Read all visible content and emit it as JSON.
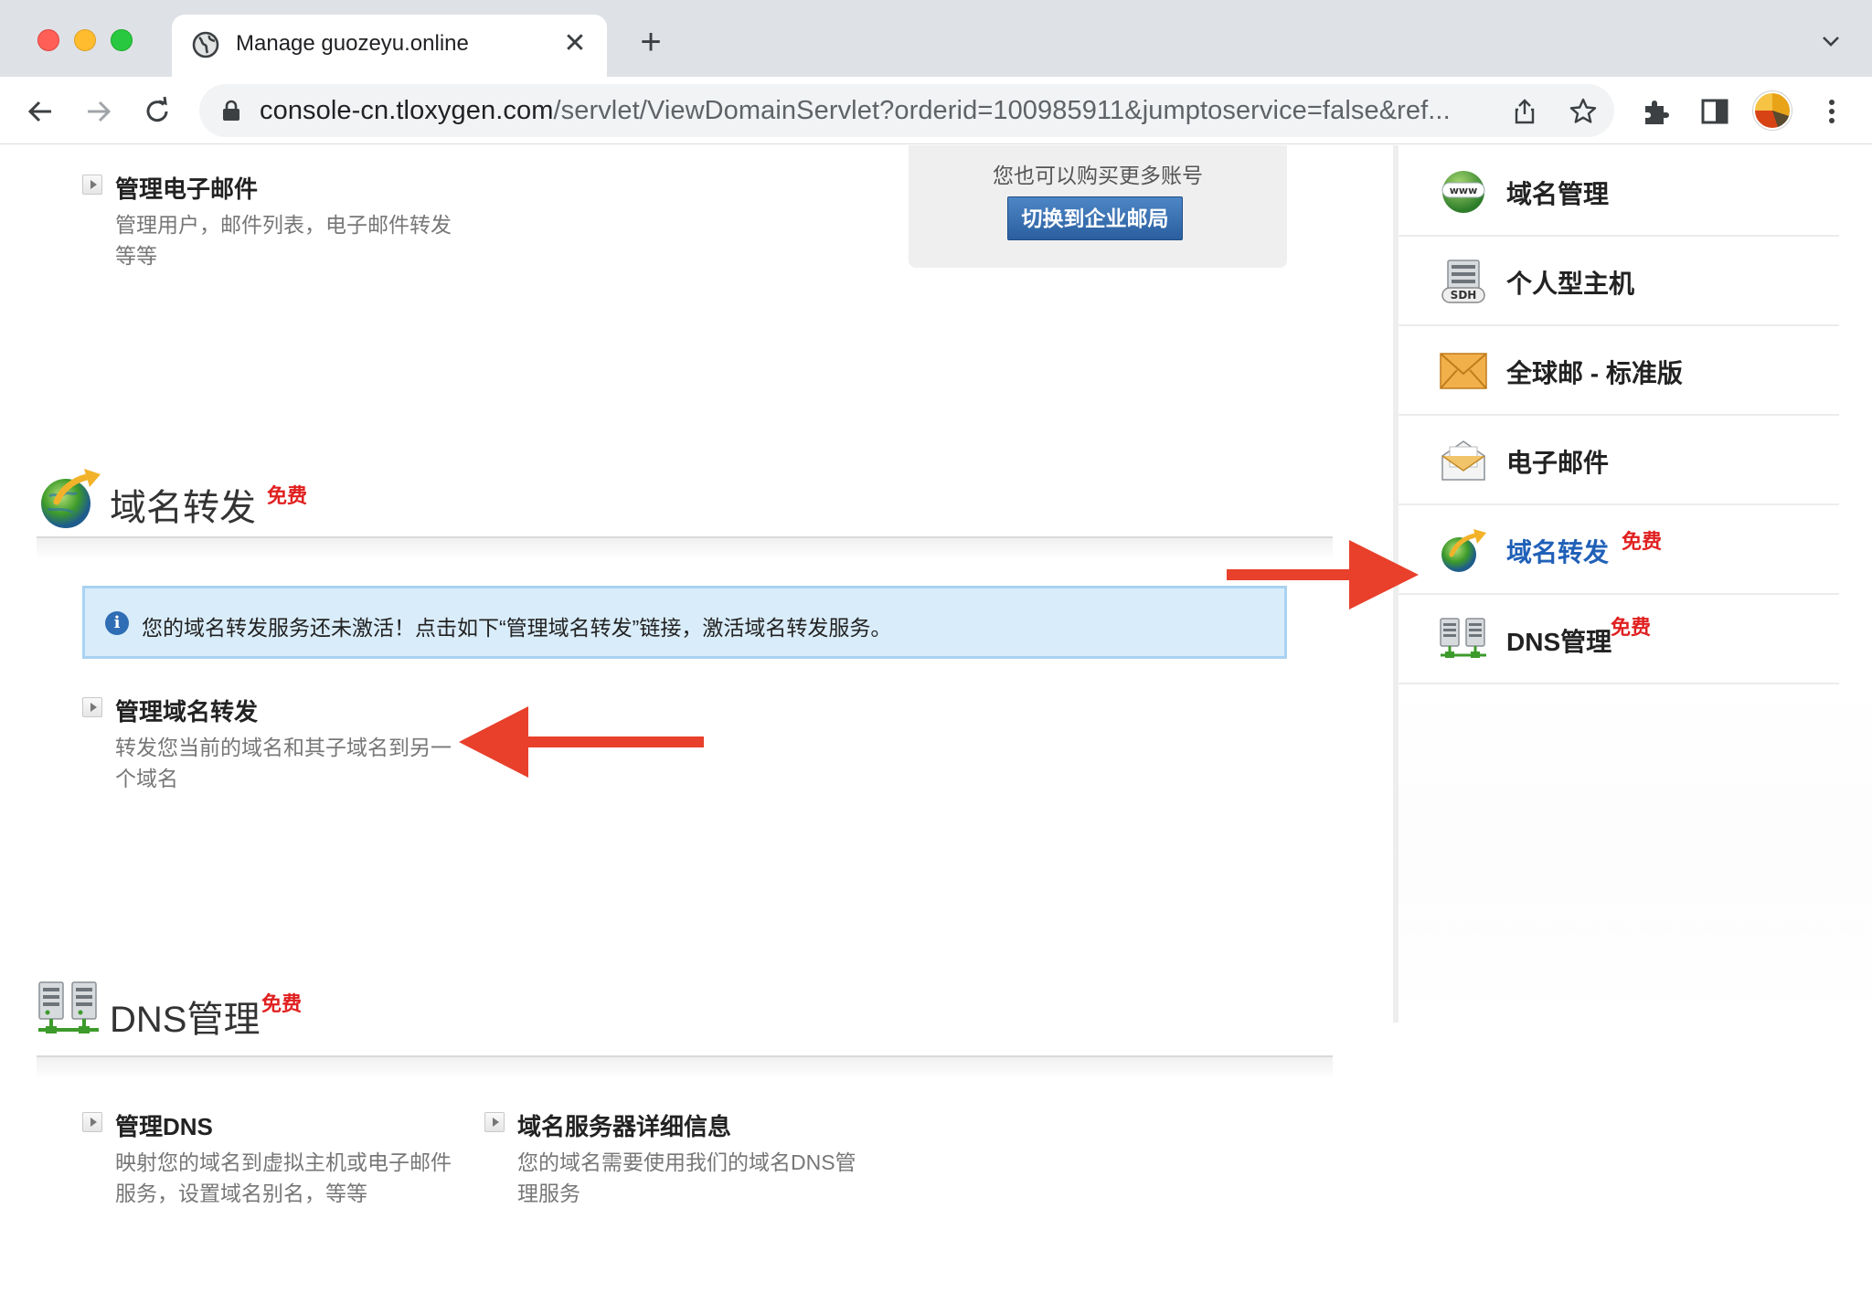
{
  "browser": {
    "tab_title": "Manage guozeyu.online",
    "url_host": "console-cn.tloxygen.com",
    "url_rest": "/servlet/ViewDomainServlet?orderid=100985911&jumptoservice=false&ref..."
  },
  "email_section": {
    "title": "管理电子邮件",
    "desc": "管理用户，邮件列表，电子邮件转发等等",
    "buy_more_text": "您也可以购买更多账号",
    "switch_button": "切换到企业邮局"
  },
  "forwarding_section": {
    "heading": "域名转发",
    "free_badge": "免费",
    "notice": "您的域名转发服务还未激活！点击如下“管理域名转发”链接，激活域名转发服务。",
    "manage_title": "管理域名转发",
    "manage_desc": "转发您当前的域名和其子域名到另一个域名"
  },
  "dns_section": {
    "heading": "DNS管理",
    "free_badge": "免费",
    "items": [
      {
        "title": "管理DNS",
        "desc": "映射您的域名到虚拟主机或电子邮件服务，设置域名别名，等等"
      },
      {
        "title": "域名服务器详细信息",
        "desc": "您的域名需要使用我们的域名DNS管理服务"
      }
    ]
  },
  "sidebar": {
    "items": [
      {
        "label": "域名管理",
        "icon": "www-globe-icon"
      },
      {
        "label": "个人型主机",
        "icon": "sdh-server-icon"
      },
      {
        "label": "全球邮 - 标准版",
        "icon": "envelope-icon"
      },
      {
        "label": "电子邮件",
        "icon": "open-envelope-icon"
      },
      {
        "label": "域名转发",
        "icon": "forward-globe-icon",
        "free": "免费",
        "active": true
      },
      {
        "label": "DNS管理",
        "icon": "dns-servers-icon",
        "free": "免费"
      }
    ]
  },
  "colors": {
    "free_badge": "#e02020",
    "active_link": "#2060b8",
    "annotation_arrow": "#e8402b",
    "notice_bg": "#d9ecf9"
  }
}
